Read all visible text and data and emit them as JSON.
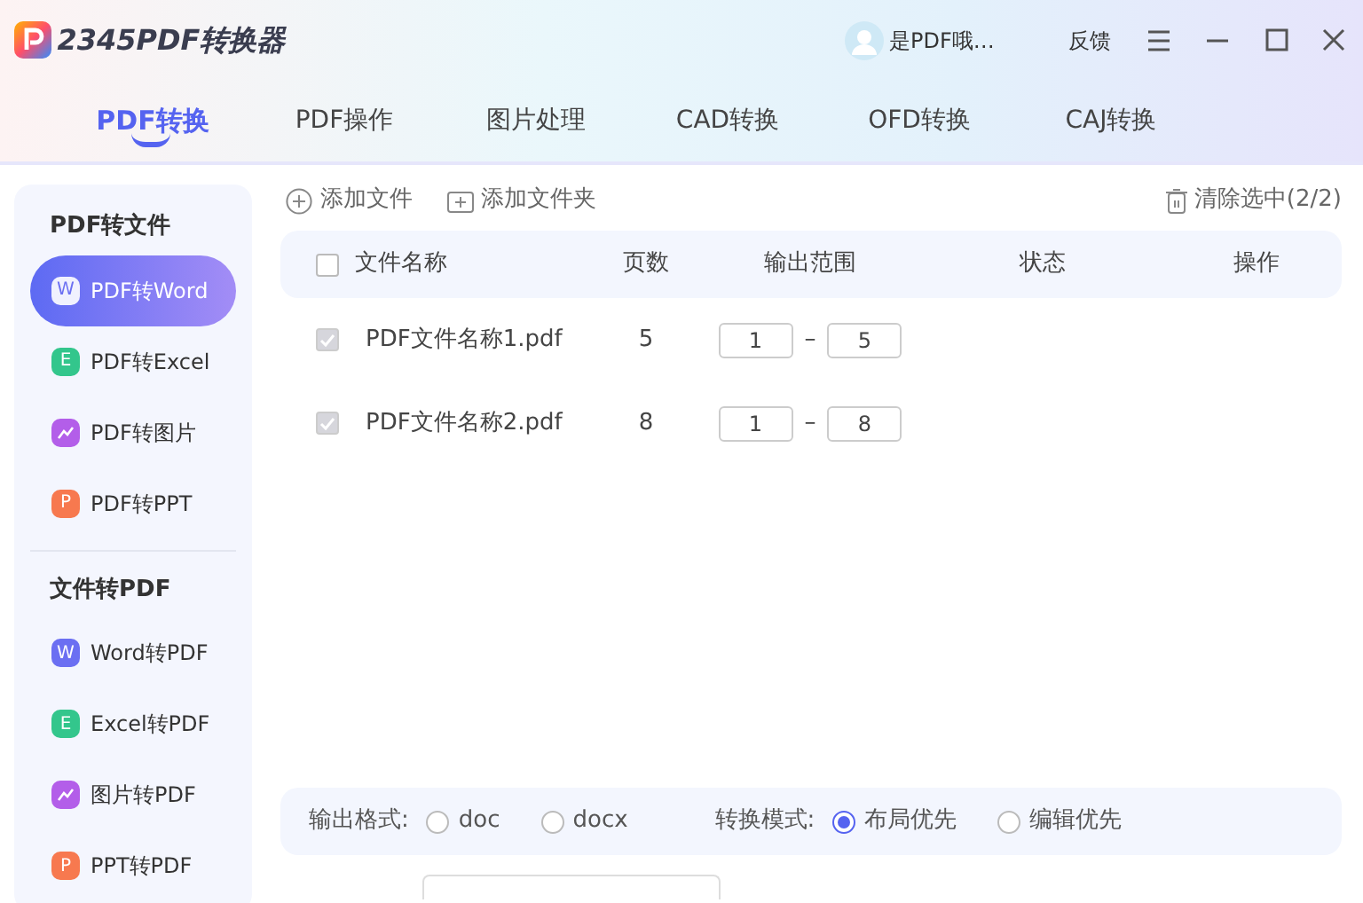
{
  "app": {
    "title": "2345PDF转换器"
  },
  "user": {
    "name": "是PDF哦…"
  },
  "header_actions": [
    "反馈"
  ],
  "tabs": [
    {
      "label": "PDF转换",
      "selected": true
    },
    {
      "label": "PDF操作",
      "selected": false
    },
    {
      "label": "图片处理",
      "selected": false
    },
    {
      "label": "CAD转换",
      "selected": false
    },
    {
      "label": "OFD转换",
      "selected": false
    },
    {
      "label": "CAJ转换",
      "selected": false
    }
  ],
  "sidebar": {
    "sections": [
      {
        "title": "PDF转文件",
        "items": [
          {
            "label": "PDF转Word",
            "kind": "letter",
            "icon_text": "W",
            "color": "#6b6ff2",
            "selected": true
          },
          {
            "label": "PDF转Excel",
            "kind": "letter",
            "icon_text": "E",
            "color": "#33c68c",
            "selected": false
          },
          {
            "label": "PDF转图片",
            "kind": "image",
            "color": "#b35ee9",
            "selected": false
          },
          {
            "label": "PDF转PPT",
            "kind": "letter",
            "icon_text": "P",
            "color": "#f7794f",
            "selected": false
          }
        ]
      },
      {
        "title": "文件转PDF",
        "items": [
          {
            "label": "Word转PDF",
            "kind": "letter",
            "icon_text": "W",
            "color": "#6b6ff2",
            "selected": false
          },
          {
            "label": "Excel转PDF",
            "kind": "letter",
            "icon_text": "E",
            "color": "#33c68c",
            "selected": false
          },
          {
            "label": "图片转PDF",
            "kind": "image",
            "color": "#b35ee9",
            "selected": false
          },
          {
            "label": "PPT转PDF",
            "kind": "letter",
            "icon_text": "P",
            "color": "#f7794f",
            "selected": false
          }
        ]
      }
    ]
  },
  "toolbar": [
    {
      "label": "添加文件",
      "kind": "add-file"
    },
    {
      "label": "添加文件夹",
      "kind": "add-folder"
    }
  ],
  "clear_button": {
    "label": "清除选中(2/2)"
  },
  "table": {
    "select_all": false,
    "columns": [
      "文件名称",
      "页数",
      "输出范围",
      "状态",
      "操作"
    ],
    "rows": [
      {
        "checked": true,
        "name": "PDF文件名称1.pdf",
        "pages": "5",
        "range_from": "1",
        "range_separator": "–",
        "range_to": "5"
      },
      {
        "checked": true,
        "name": "PDF文件名称2.pdf",
        "pages": "8",
        "range_from": "1",
        "range_separator": "–",
        "range_to": "8"
      }
    ]
  },
  "options": [
    {
      "label": "输出格式:",
      "choices": [
        {
          "label": "doc",
          "selected": false
        },
        {
          "label": "docx",
          "selected": false
        }
      ]
    },
    {
      "label": "转换模式:",
      "choices": [
        {
          "label": "布局优先",
          "selected": true
        },
        {
          "label": "编辑优先",
          "selected": false
        }
      ]
    }
  ]
}
